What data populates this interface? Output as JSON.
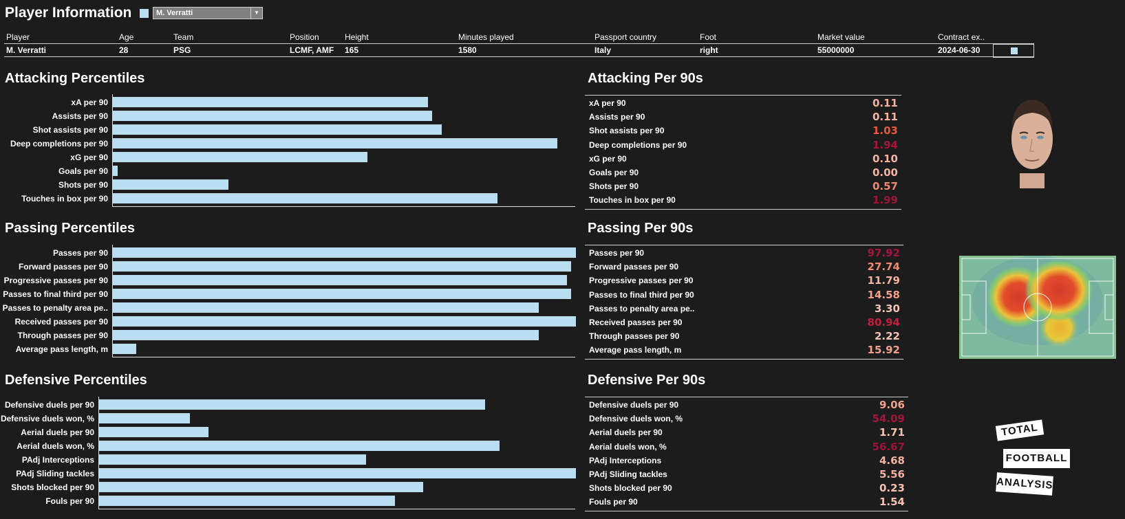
{
  "header": {
    "title": "Player Information",
    "legend_color": "#b9ddf1",
    "player_select": {
      "value": "M. Verratti",
      "arrow": "▼"
    }
  },
  "info_table": {
    "columns": [
      "Player",
      "Age",
      "Team",
      "Position",
      "Height",
      "Minutes played",
      "Passport country",
      "Foot",
      "Market value",
      "Contract ex.."
    ],
    "row": [
      "M. Verratti",
      "28",
      "PSG",
      "LCMF, AMF",
      "165",
      "1580",
      "Italy",
      "right",
      "55000000",
      "2024-06-30"
    ]
  },
  "sections": {
    "attacking_pct_title": "Attacking Percentiles",
    "passing_pct_title": "Passing Percentiles",
    "defensive_pct_title": "Defensive Percentiles",
    "attacking_p90_title": "Attacking Per 90s",
    "passing_p90_title": "Passing Per 90s",
    "defensive_p90_title": "Defensive Per 90s"
  },
  "chart_data": [
    {
      "type": "bar",
      "orientation": "horizontal",
      "title": "Attacking Percentiles",
      "categories": [
        "xA per 90",
        "Assists per 90",
        "Shot assists per 90",
        "Deep completions per 90",
        "xG per 90",
        "Goals per 90",
        "Shots per 90",
        "Touches in box per 90"
      ],
      "values": [
        68,
        69,
        71,
        96,
        55,
        1,
        25,
        83
      ],
      "xlim": [
        0,
        100
      ],
      "color": "#b9ddf1"
    },
    {
      "type": "bar",
      "orientation": "horizontal",
      "title": "Passing Percentiles",
      "categories": [
        "Passes per 90",
        "Forward passes per 90",
        "Progressive passes per 90",
        "Passes to final third per 90",
        "Passes to penalty area pe..",
        "Received passes per 90",
        "Through passes per 90",
        "Average pass length, m"
      ],
      "values": [
        100,
        99,
        98,
        99,
        92,
        100,
        92,
        5
      ],
      "xlim": [
        0,
        100
      ],
      "color": "#b9ddf1"
    },
    {
      "type": "bar",
      "orientation": "horizontal",
      "title": "Defensive Percentiles",
      "categories": [
        "Defensive duels per 90",
        "Defensive duels won, %",
        "Aerial duels per 90",
        "Aerial duels won, %",
        "PAdj Interceptions",
        "PAdj Sliding tackles",
        "Shots blocked per 90",
        "Fouls per 90"
      ],
      "values": [
        81,
        19,
        23,
        84,
        56,
        100,
        68,
        62
      ],
      "xlim": [
        0,
        100
      ],
      "color": "#b9ddf1"
    },
    {
      "type": "table",
      "title": "Attacking Per 90s",
      "rows": [
        {
          "label": "xA per 90",
          "value": "0.11",
          "color": "#f4b3a0"
        },
        {
          "label": "Assists per 90",
          "value": "0.11",
          "color": "#f4b3a0"
        },
        {
          "label": "Shot assists per 90",
          "value": "1.03",
          "color": "#e8583d"
        },
        {
          "label": "Deep completions per 90",
          "value": "1.94",
          "color": "#a8153a"
        },
        {
          "label": "xG per 90",
          "value": "0.10",
          "color": "#f4b3a0"
        },
        {
          "label": "Goals per 90",
          "value": "0.00",
          "color": "#f4b3a0"
        },
        {
          "label": "Shots per 90",
          "value": "0.57",
          "color": "#ef8a70"
        },
        {
          "label": "Touches in box per 90",
          "value": "1.99",
          "color": "#9e1436"
        }
      ]
    },
    {
      "type": "table",
      "title": "Passing Per 90s",
      "rows": [
        {
          "label": "Passes per 90",
          "value": "97.92",
          "color": "#a8153a"
        },
        {
          "label": "Forward passes per 90",
          "value": "27.74",
          "color": "#ef8a70"
        },
        {
          "label": "Progressive passes per 90",
          "value": "11.79",
          "color": "#f4b3a0"
        },
        {
          "label": "Passes to final third per 90",
          "value": "14.58",
          "color": "#f2a08a"
        },
        {
          "label": "Passes to penalty area pe..",
          "value": "3.30",
          "color": "#f6c2b2"
        },
        {
          "label": "Received passes per 90",
          "value": "80.94",
          "color": "#c21e3f"
        },
        {
          "label": "Through passes per 90",
          "value": "2.22",
          "color": "#f6c2b2"
        },
        {
          "label": "Average pass length, m",
          "value": "15.92",
          "color": "#f2a08a"
        }
      ]
    },
    {
      "type": "table",
      "title": "Defensive Per 90s",
      "rows": [
        {
          "label": "Defensive duels per 90",
          "value": "9.06",
          "color": "#f2a08a"
        },
        {
          "label": "Defensive duels won, %",
          "value": "54.09",
          "color": "#a8153a"
        },
        {
          "label": "Aerial duels per 90",
          "value": "1.71",
          "color": "#f6c2b2"
        },
        {
          "label": "Aerial duels won, %",
          "value": "56.67",
          "color": "#9e1436"
        },
        {
          "label": "PAdj Interceptions",
          "value": "4.68",
          "color": "#f4b3a0"
        },
        {
          "label": "PAdj Sliding tackles",
          "value": "5.56",
          "color": "#f4b3a0"
        },
        {
          "label": "Shots blocked per 90",
          "value": "0.23",
          "color": "#f6c2b2"
        },
        {
          "label": "Fouls per 90",
          "value": "1.54",
          "color": "#f6c2b2"
        }
      ]
    }
  ],
  "images": {
    "player_photo": "player-headshot",
    "heatmap": "pitch-heatmap"
  },
  "logo": {
    "line1": "TOTAL",
    "line2": "FOOTBALL",
    "line3": "ANALYSIS"
  }
}
